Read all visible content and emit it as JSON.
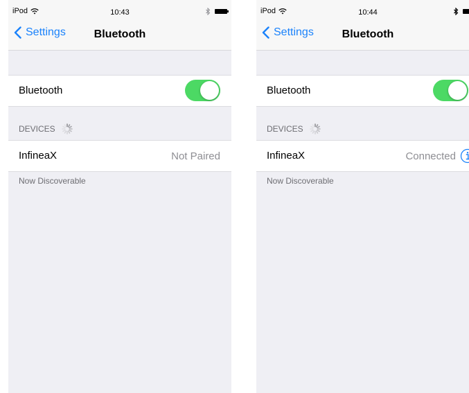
{
  "colors": {
    "accent": "#1a82fb",
    "toggle_on": "#4cd964",
    "background": "#efeff4",
    "secondary_text": "#8e8e93"
  },
  "left": {
    "status": {
      "carrier": "iPod",
      "time": "10:43"
    },
    "nav": {
      "back_label": "Settings",
      "title": "Bluetooth"
    },
    "bluetooth_row": {
      "label": "Bluetooth",
      "enabled": true
    },
    "devices_header": "DEVICES",
    "device": {
      "name": "InfineaX",
      "status": "Not Paired"
    },
    "footer": "Now Discoverable"
  },
  "right": {
    "status": {
      "carrier": "iPod",
      "time": "10:44"
    },
    "nav": {
      "back_label": "Settings",
      "title": "Bluetooth"
    },
    "bluetooth_row": {
      "label": "Bluetooth",
      "enabled": true
    },
    "devices_header": "DEVICES",
    "device": {
      "name": "InfineaX",
      "status": "Connected"
    },
    "footer": "Now Discoverable"
  },
  "icons": [
    "wifi-icon",
    "bluetooth-icon",
    "battery-icon",
    "chevron-left-icon",
    "spinner-icon",
    "info-icon"
  ]
}
